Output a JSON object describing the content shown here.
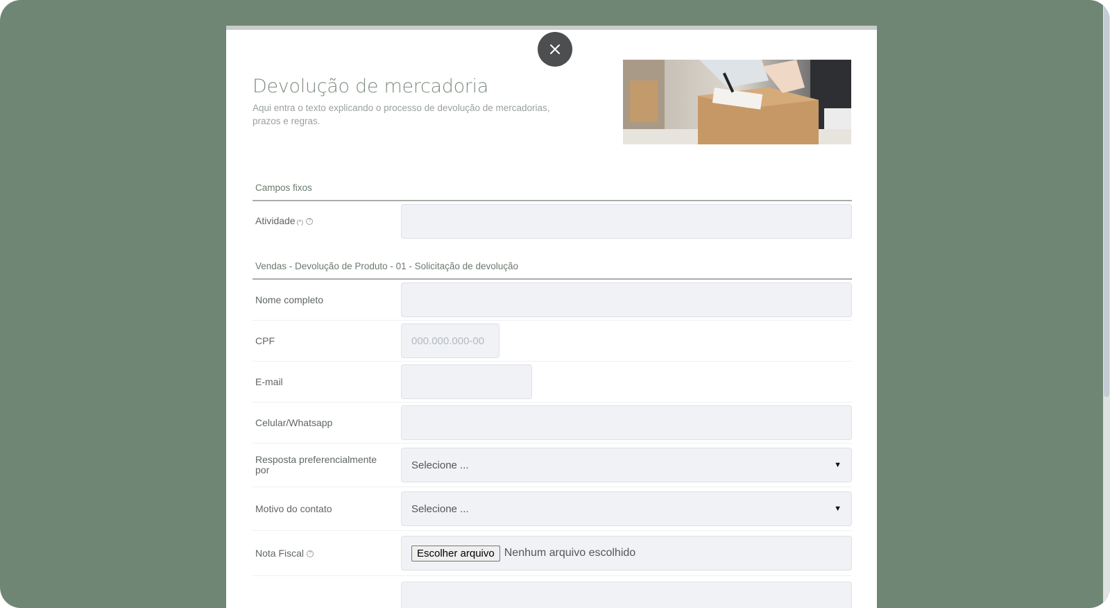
{
  "modal": {
    "title": "Devolução de mercadoria",
    "subtitle": "Aqui entra o texto explicando o processo de devolução de mercadorias, prazos e regras.",
    "close_icon": "close-icon",
    "hero_image": "package-shipping-photo"
  },
  "form": {
    "sections": [
      {
        "title": "Campos fixos"
      },
      {
        "title": "Vendas - Devolução de Produto - 01 - Solicitação de devolução"
      }
    ],
    "fields": {
      "atividade": {
        "label": "Atividade",
        "required_mark": "(*)",
        "value": ""
      },
      "nome": {
        "label": "Nome completo",
        "value": ""
      },
      "cpf": {
        "label": "CPF",
        "placeholder": "000.000.000-00",
        "value": ""
      },
      "email": {
        "label": "E-mail",
        "value": ""
      },
      "celular": {
        "label": "Celular/Whatsapp",
        "value": ""
      },
      "resposta": {
        "label": "Resposta preferencialmente por",
        "selected": "Selecione ..."
      },
      "motivo": {
        "label": "Motivo do contato",
        "selected": "Selecione ..."
      },
      "nota": {
        "label": "Nota Fiscal",
        "button": "Escolher arquivo",
        "status": "Nenhum arquivo escolhido"
      }
    }
  },
  "colors": {
    "backdrop": "#708675",
    "close_button": "#4d4e50",
    "title": "#7d8c80",
    "input_bg": "#f1f2f6"
  }
}
